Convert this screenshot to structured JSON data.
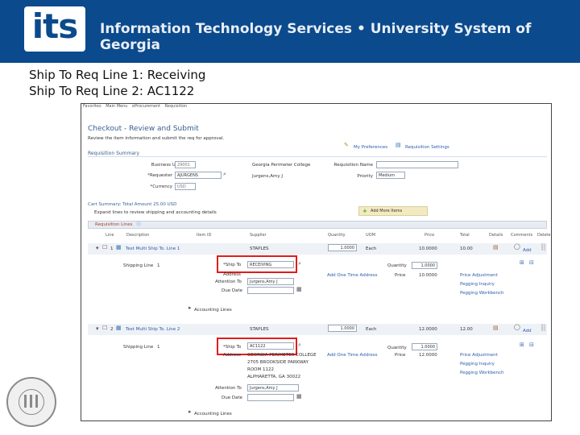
{
  "banner": {
    "logo": "its",
    "title": "Information Technology Services • University System of Georgia"
  },
  "slide": {
    "line1": "Ship To Req Line 1:  Receiving",
    "line2": "Ship To Req Line 2:  AC1122"
  },
  "screenshot": {
    "breadcrumbs": [
      "Favorites",
      "Main Menu",
      "eProcurement",
      "Requisition"
    ],
    "title": "Checkout - Review and Submit",
    "subtitle": "Review the item information and submit the req for approval.",
    "my_preferences": "My Preferences",
    "requisition_settings": "Requisition Settings",
    "summary_head": "Requisition Summary",
    "business_unit_label": "Business Unit",
    "business_unit_value": "29001",
    "business_unit_desc": "Georgia Perimeter College",
    "requester_label": "*Requester",
    "requester_value": "AJURGENS",
    "requester_desc": "Jurgens,Amy J",
    "currency_label": "*Currency",
    "currency_value": "USD",
    "req_name_label": "Requisition Name",
    "priority_label": "Priority",
    "priority_value": "Medium",
    "cart_summary": "Cart Summary: Total Amount 25.00 USD",
    "expand_lines": "Expand lines to review shipping and accounting details",
    "add_more_items": "Add More Items",
    "grid_title": "Requisition Lines",
    "columns": [
      "Line",
      "Description",
      "Item ID",
      "Supplier",
      "Quantity",
      "UOM",
      "Price",
      "Total",
      "Details",
      "Comments",
      "Delete"
    ],
    "lines": [
      {
        "line": "1",
        "description": "Test Multi Ship To. Line 1",
        "supplier": "STAPLES",
        "quantity": "1.0000",
        "uom": "Each",
        "price": "10.0000",
        "total": "10.00",
        "comments": "Add",
        "shipping_line": "Shipping Line",
        "shipping_line_no": "1",
        "ship_to_label": "*Ship To",
        "ship_to_value": "RECEIVING",
        "address_label": "Address",
        "attention_label": "Attention To",
        "attention_value": "Jurgens,Amy J",
        "due_date_label": "Due Date",
        "one_time_address": "Add One Time Address",
        "quantity_label": "Quantity",
        "qty_value": "1.0000",
        "price_label": "Price",
        "price_value": "10.0000",
        "price_adjustment": "Price Adjustment",
        "pegging_inquiry": "Pegging Inquiry",
        "pegging_workbench": "Pegging Workbench",
        "accounting_lines": "Accounting Lines"
      },
      {
        "line": "2",
        "description": "Test Multi Ship To. Line 2",
        "supplier": "STAPLES",
        "quantity": "1.0000",
        "uom": "Each",
        "price": "12.0000",
        "total": "12.00",
        "comments": "Add",
        "shipping_line": "Shipping Line",
        "shipping_line_no": "1",
        "ship_to_label": "*Ship To",
        "ship_to_value": "AC1122",
        "address_label": "Address",
        "address_lines": [
          "GEORGIA PERIMETER COLLEGE",
          "2705 BROOKSIDE PARKWAY",
          "ROOM 1122",
          "ALPHARETTA, GA 30022"
        ],
        "attention_label": "Attention To",
        "attention_value": "Jurgens,Amy J",
        "due_date_label": "Due Date",
        "one_time_address": "Add One Time Address",
        "quantity_label": "Quantity",
        "qty_value": "1.0000",
        "price_label": "Price",
        "price_value": "12.0000",
        "price_adjustment": "Price Adjustment",
        "pegging_inquiry": "Pegging Inquiry",
        "pegging_workbench": "Pegging Workbench",
        "accounting_lines": "Accounting Lines"
      }
    ]
  },
  "colors": {
    "banner": "#0b4a8c",
    "highlight": "#e21b1b",
    "link": "#2a5caa"
  }
}
